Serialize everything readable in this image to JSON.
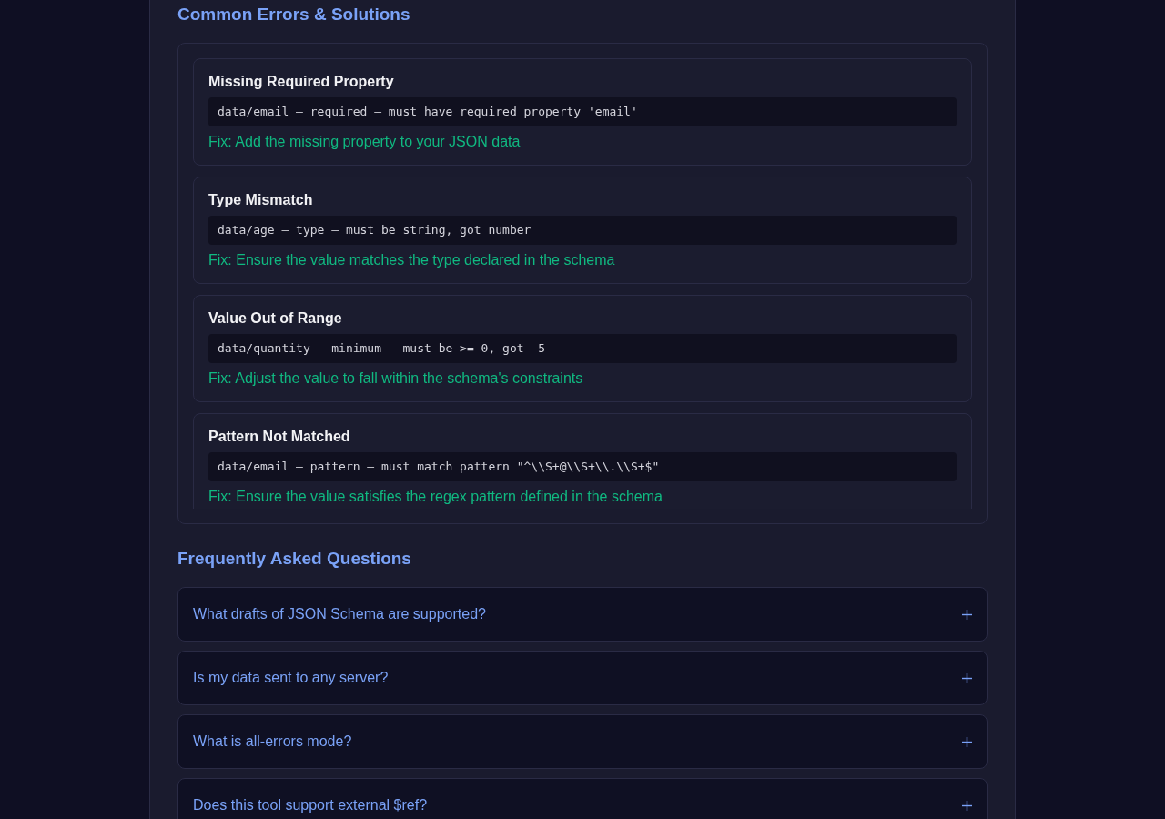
{
  "errors_section": {
    "title": "Common Errors & Solutions",
    "errors": [
      {
        "title": "Missing Required Property",
        "code": "data/email — required — must have required property 'email'",
        "fix": "Fix: Add the missing property to your JSON data"
      },
      {
        "title": "Type Mismatch",
        "code": "data/age — type — must be string, got number",
        "fix": "Fix: Ensure the value matches the type declared in the schema"
      },
      {
        "title": "Value Out of Range",
        "code": "data/quantity — minimum — must be >= 0, got -5",
        "fix": "Fix: Adjust the value to fall within the schema's constraints"
      },
      {
        "title": "Pattern Not Matched",
        "code": "data/email — pattern — must match pattern \"^\\\\S+@\\\\S+\\\\.\\\\S+$\"",
        "fix": "Fix: Ensure the value satisfies the regex pattern defined in the schema"
      }
    ]
  },
  "faq_section": {
    "title": "Frequently Asked Questions",
    "items": [
      {
        "question": "What drafts of JSON Schema are supported?",
        "expanded": false
      },
      {
        "question": "Is my data sent to any server?",
        "expanded": false
      },
      {
        "question": "What is all-errors mode?",
        "expanded": false
      },
      {
        "question": "Does this tool support external $ref?",
        "expanded": false
      }
    ]
  }
}
